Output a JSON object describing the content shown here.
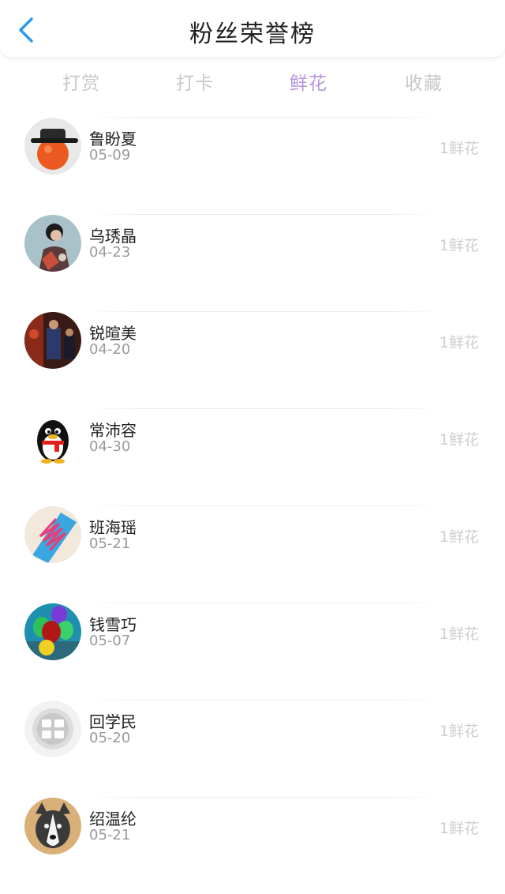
{
  "header": {
    "title": "粉丝荣誉榜",
    "back_icon": "chevron-left-icon",
    "accent_color": "#2a9af0"
  },
  "tabs": [
    {
      "label": "打赏",
      "active": false
    },
    {
      "label": "打卡",
      "active": false
    },
    {
      "label": "鲜花",
      "active": true
    },
    {
      "label": "收藏",
      "active": false
    }
  ],
  "active_tab_color": "#b896e0",
  "fans": [
    {
      "name": "鲁盼夏",
      "date": "05-09",
      "amount": "1鲜花",
      "avatar": "hat-orange-avatar"
    },
    {
      "name": "乌琇晶",
      "date": "04-23",
      "amount": "1鲜花",
      "avatar": "woman-portrait-avatar"
    },
    {
      "name": "锐暄美",
      "date": "04-20",
      "amount": "1鲜花",
      "avatar": "stage-photo-avatar"
    },
    {
      "name": "常沛容",
      "date": "04-30",
      "amount": "1鲜花",
      "avatar": "qq-penguin-avatar"
    },
    {
      "name": "班海瑶",
      "date": "05-21",
      "amount": "1鲜花",
      "avatar": "shoe-laces-avatar"
    },
    {
      "name": "钱雪巧",
      "date": "05-07",
      "amount": "1鲜花",
      "avatar": "balloons-avatar"
    },
    {
      "name": "回学民",
      "date": "05-20",
      "amount": "1鲜花",
      "avatar": "stamp-avatar"
    },
    {
      "name": "绍温纶",
      "date": "05-21",
      "amount": "1鲜花",
      "avatar": "husky-dog-avatar"
    }
  ]
}
